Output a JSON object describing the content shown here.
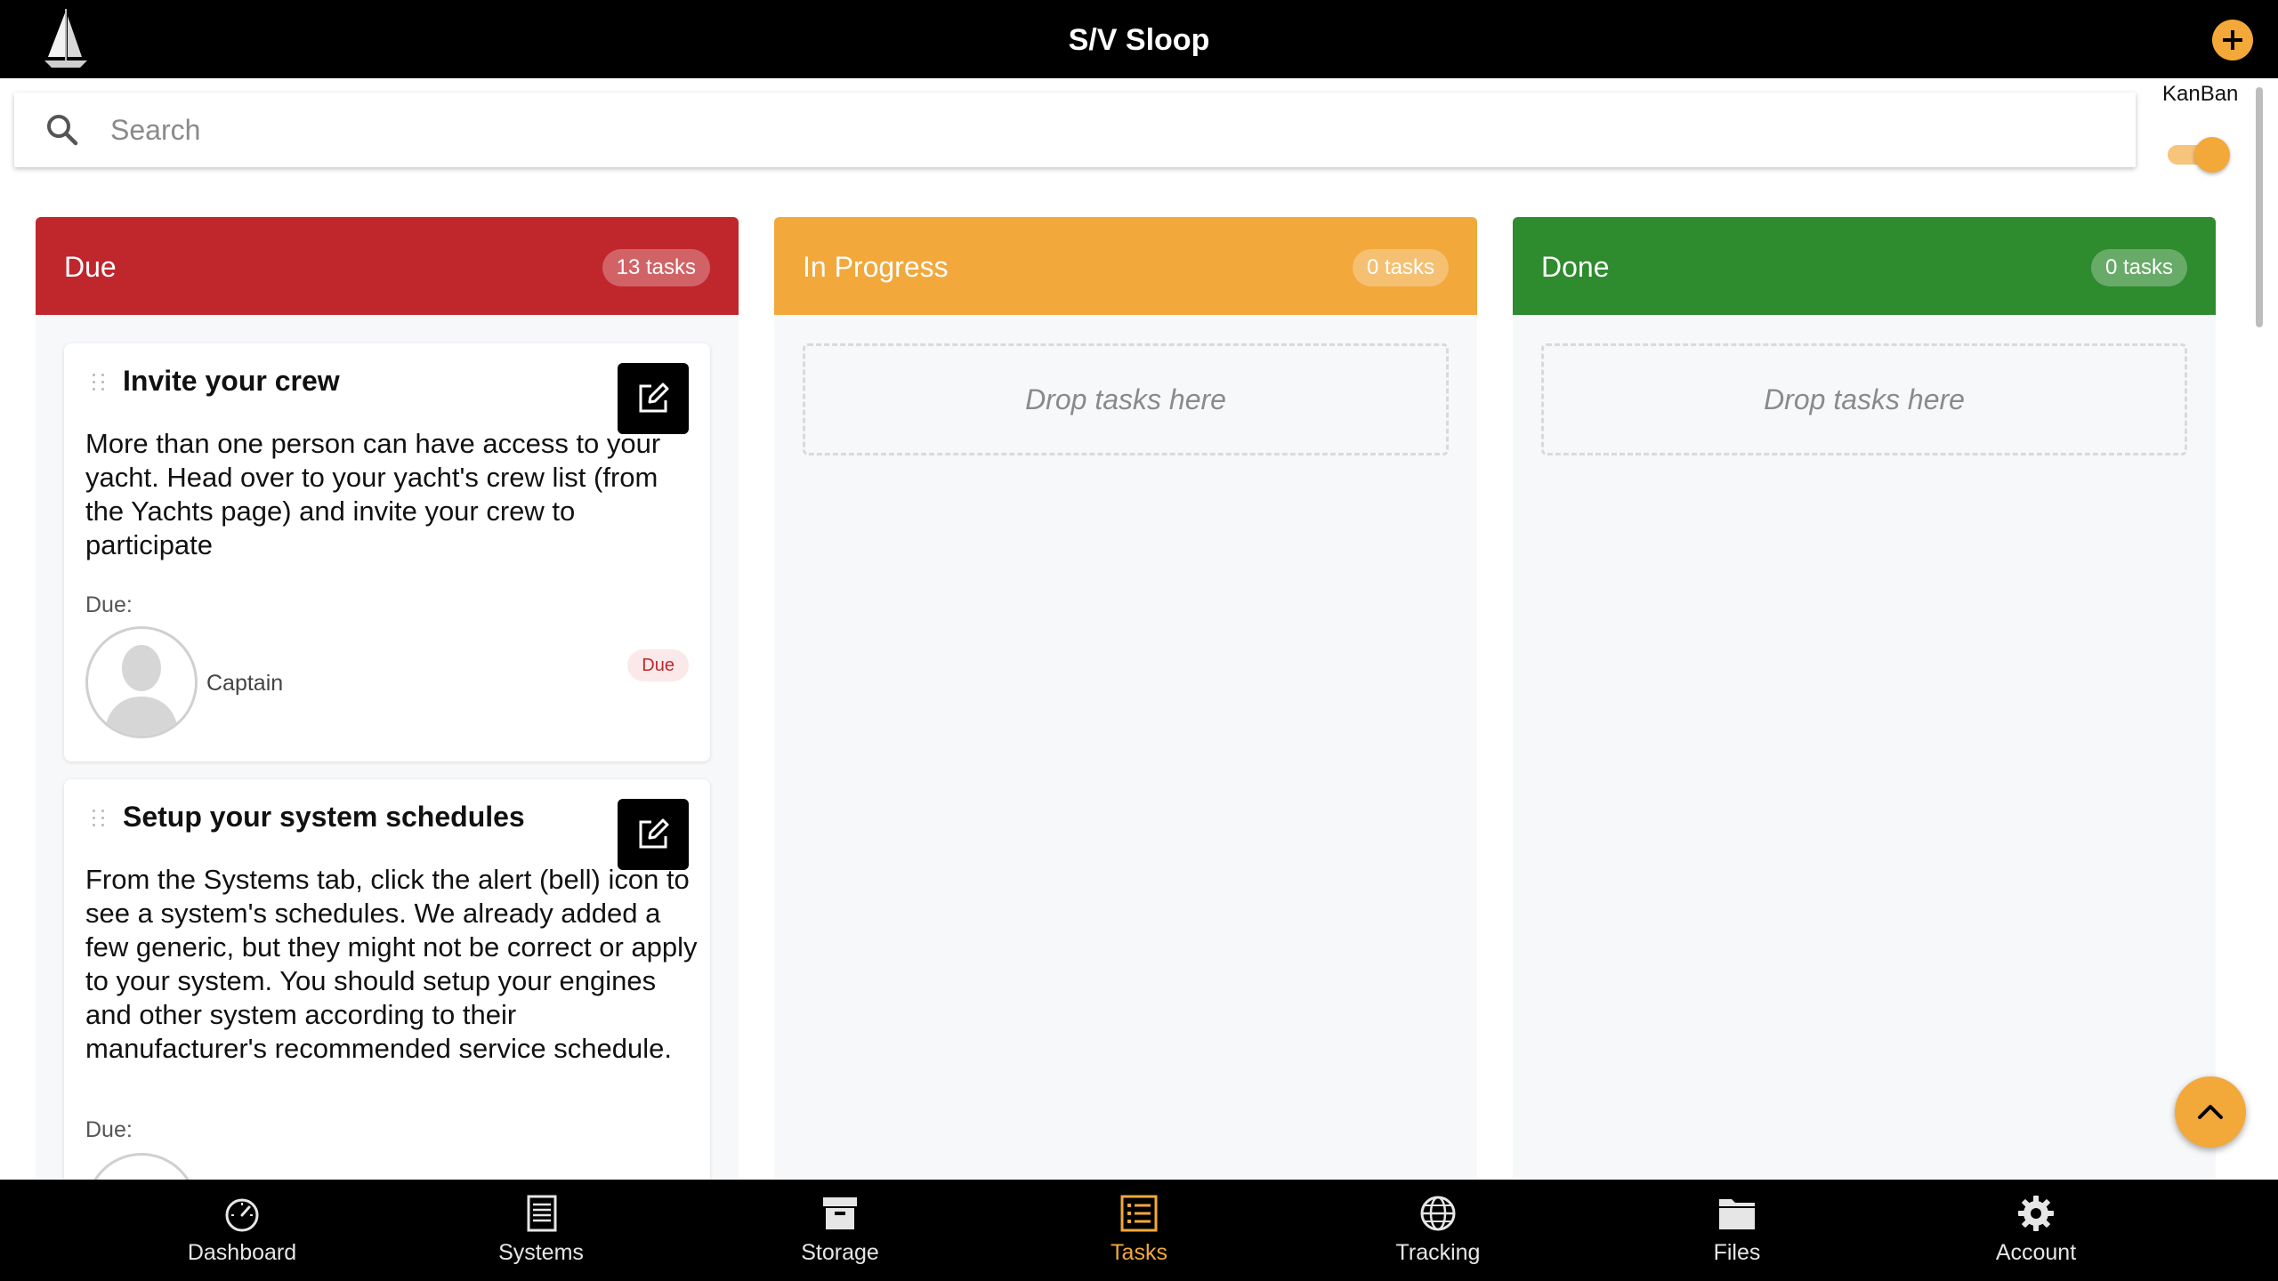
{
  "header": {
    "title": "S/V Sloop"
  },
  "search": {
    "placeholder": "Search",
    "value": ""
  },
  "view_toggle": {
    "label": "KanBan",
    "on": true
  },
  "columns": [
    {
      "title": "Due",
      "count": "13 tasks",
      "color": "#c0272d"
    },
    {
      "title": "In Progress",
      "count": "0 tasks",
      "color": "#f2a83b",
      "drop_text": "Drop tasks here"
    },
    {
      "title": "Done",
      "count": "0 tasks",
      "color": "#2e8b2e",
      "drop_text": "Drop tasks here"
    }
  ],
  "tasks": [
    {
      "title": "Invite your crew",
      "description": "More than one person can have access to your yacht. Head over to your yacht's crew list (from the Yachts page) and invite your crew to participate",
      "due_label": "Due:",
      "assignee": "Captain",
      "status": "Due"
    },
    {
      "title": "Setup your system schedules",
      "description": "From the Systems tab, click the alert (bell) icon to see a system's schedules. We already added a few generic, but they might not be correct or apply to your system. You should setup your engines and other system according to their manufacturer's recommended service schedule.",
      "due_label": "Due:"
    }
  ],
  "nav": [
    {
      "label": "Dashboard",
      "icon": "gauge-icon"
    },
    {
      "label": "Systems",
      "icon": "document-icon"
    },
    {
      "label": "Storage",
      "icon": "archive-box-icon"
    },
    {
      "label": "Tasks",
      "icon": "checklist-icon",
      "active": true
    },
    {
      "label": "Tracking",
      "icon": "globe-icon"
    },
    {
      "label": "Files",
      "icon": "folder-icon"
    },
    {
      "label": "Account",
      "icon": "gear-icon"
    }
  ],
  "colors": {
    "accent": "#f3a83a",
    "bar": "#000000"
  }
}
